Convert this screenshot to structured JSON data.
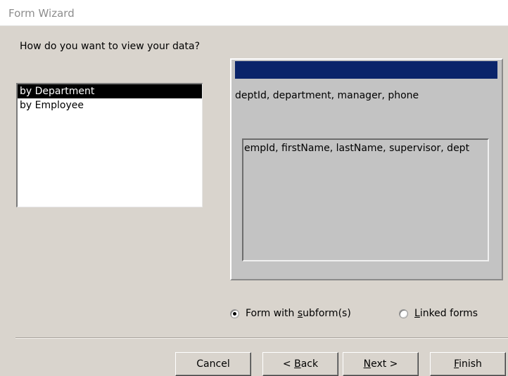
{
  "window": {
    "title": "Form Wizard"
  },
  "question": "How do you want to view your data?",
  "view_list": {
    "items": [
      {
        "label": "by Department",
        "selected": true
      },
      {
        "label": "by Employee",
        "selected": false
      }
    ]
  },
  "preview": {
    "main_fields": "deptId, department, manager, phone",
    "subform_fields": "empId, firstName, lastName, supervisor, dept",
    "header_color": "#0a246a"
  },
  "layout_options": {
    "form_with_subforms": {
      "before": "Form with ",
      "accel": "s",
      "after": "ubform(s)",
      "selected": true
    },
    "linked_forms": {
      "before": "",
      "accel": "L",
      "after": "inked forms",
      "selected": false
    }
  },
  "buttons": {
    "cancel": {
      "label": "Cancel"
    },
    "back": {
      "before": "< ",
      "accel": "B",
      "after": "ack"
    },
    "next": {
      "before": "",
      "accel": "N",
      "after": "ext >"
    },
    "finish": {
      "before": "",
      "accel": "F",
      "after": "inish"
    }
  }
}
